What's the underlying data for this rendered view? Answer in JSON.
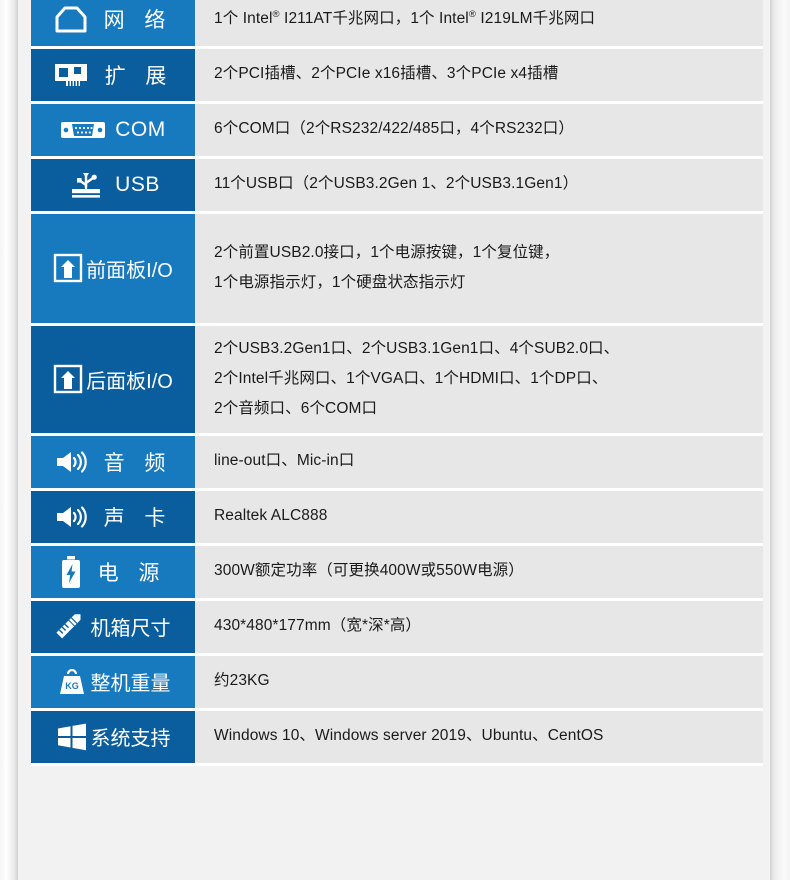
{
  "colors": {
    "blue_light": "#1779be",
    "blue_dark": "#0b5e9e",
    "value_bg": "#e7e7e7",
    "page_bg": "#f2f2f2",
    "label_text": "#ffffff",
    "value_text": "#1a1a1a"
  },
  "spec_table": {
    "rows": [
      {
        "icon": "ethernet-port-icon",
        "label": "网 络",
        "tone": "light",
        "lines": [
          "1个 Intel® I211AT千兆网口，1个 Intel® I219LM千兆网口"
        ],
        "value_plain": "1个 Intel® I211AT千兆网口，1个 Intel® I219LM千兆网口"
      },
      {
        "icon": "expansion-card-icon",
        "label": "扩 展",
        "tone": "dark",
        "lines": [
          "2个PCI插槽、2个PCIe x16插槽、3个PCIe x4插槽"
        ],
        "value_plain": "2个PCI插槽、2个PCIe x16插槽、3个PCIe x4插槽"
      },
      {
        "icon": "db9-serial-port-icon",
        "label": "COM",
        "tone": "light",
        "lines": [
          "6个COM口（2个RS232/422/485口，4个RS232口）"
        ],
        "value_plain": "6个COM口（2个RS232/422/485口，4个RS232口）"
      },
      {
        "icon": "usb-icon",
        "label": "USB",
        "tone": "dark",
        "lines": [
          "11个USB口（2个USB3.2Gen 1、2个USB3.1Gen1）"
        ],
        "value_plain": "11个USB口（2个USB3.2Gen 1、2个USB3.1Gen1）"
      },
      {
        "icon": "front-panel-io-icon",
        "label": "前面板I/O",
        "tone": "light",
        "lines": [
          "2个前置USB2.0接口，1个电源按键，1个复位键，",
          "1个电源指示灯，1个硬盘状态指示灯"
        ]
      },
      {
        "icon": "rear-panel-io-icon",
        "label": "后面板I/O",
        "tone": "dark",
        "lines": [
          "2个USB3.2Gen1口、2个USB3.1Gen1口、4个SUB2.0口、",
          "2个Intel千兆网口、1个VGA口、1个HDMI口、1个DP口、",
          "2个音频口、6个COM口"
        ]
      },
      {
        "icon": "speaker-icon",
        "label": "音 频",
        "tone": "light",
        "lines": [
          "line-out口、Mic-in口"
        ],
        "value_plain": "line-out口、Mic-in口"
      },
      {
        "icon": "speaker-icon",
        "label": "声 卡",
        "tone": "dark",
        "lines": [
          "Realtek ALC888"
        ],
        "value_plain": "Realtek ALC888"
      },
      {
        "icon": "battery-power-icon",
        "label": "电 源",
        "tone": "light",
        "lines": [
          "300W额定功率（可更换400W或550W电源）"
        ],
        "value_plain": "300W额定功率（可更换400W或550W电源）"
      },
      {
        "icon": "ruler-pencil-icon",
        "label": "机箱尺寸",
        "tone": "dark",
        "lines": [
          "430*480*177mm（宽*深*高）"
        ],
        "value_plain": "430*480*177mm（宽*深*高）"
      },
      {
        "icon": "weight-kg-icon",
        "label": "整机重量",
        "tone": "light",
        "lines": [
          "约23KG"
        ],
        "value_plain": "约23KG"
      },
      {
        "icon": "windows-logo-icon",
        "label": "系统支持",
        "tone": "dark",
        "lines": [
          "Windows 10、Windows server 2019、Ubuntu、CentOS"
        ],
        "value_plain": "Windows 10、Windows server 2019、Ubuntu、CentOS"
      }
    ]
  }
}
